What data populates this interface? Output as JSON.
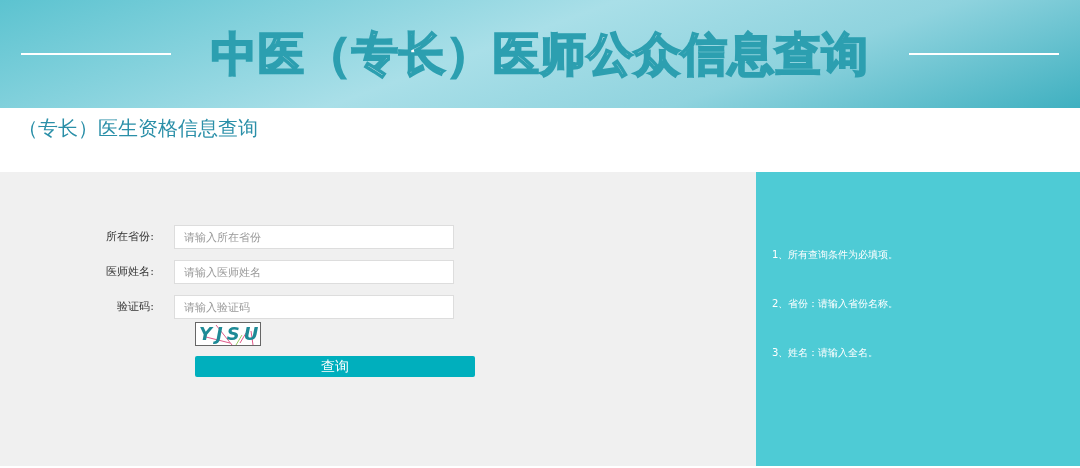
{
  "banner": {
    "title": "中医（专长）医师公众信息查询"
  },
  "page_title": "（专长）医生资格信息查询",
  "form": {
    "fields": [
      {
        "label": "所在省份:",
        "placeholder": "请输入所在省份"
      },
      {
        "label": "医师姓名:",
        "placeholder": "请输入医师姓名"
      },
      {
        "label": "验证码:",
        "placeholder": "请输入验证码"
      }
    ],
    "captcha": "YJSU",
    "submit": "查询"
  },
  "notes": [
    "1、所有查询条件为必填项。",
    "2、省份：请输入省份名称。",
    "3、姓名：请输入全名。"
  ]
}
